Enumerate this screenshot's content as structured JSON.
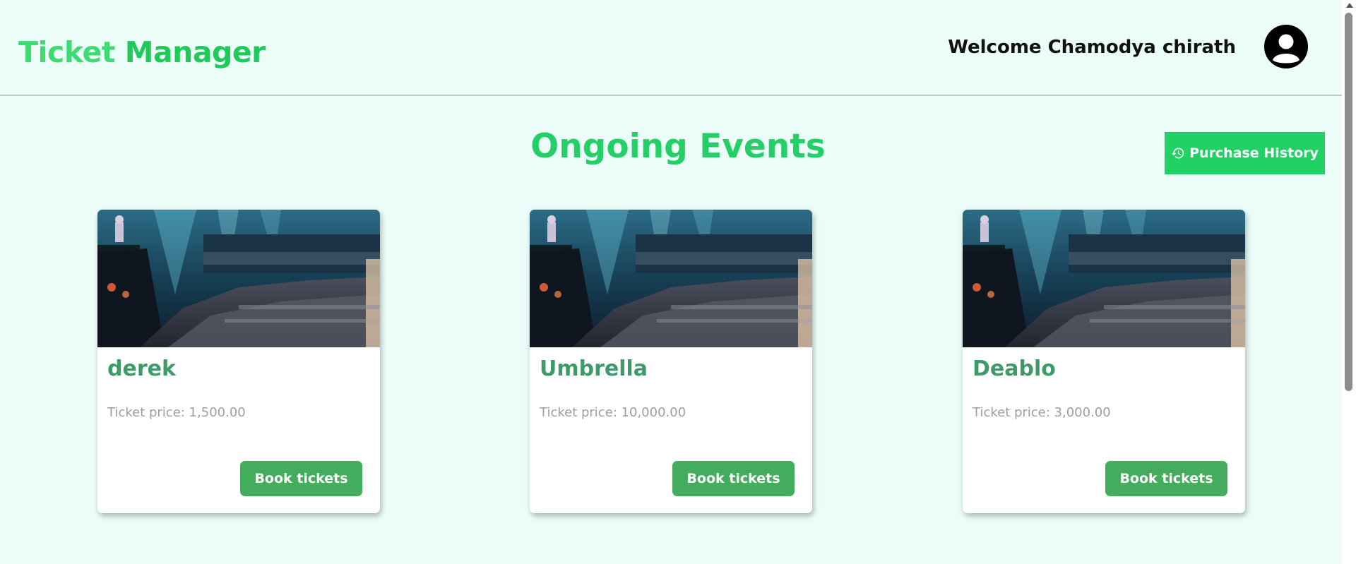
{
  "header": {
    "logo_word1": "Ticket",
    "logo_word2": "Manager",
    "welcome_text": "Welcome Chamodya chirath",
    "avatar_icon": "user-circle-icon"
  },
  "main": {
    "title": "Ongoing Events",
    "history_button": {
      "label": "Purchase History",
      "icon": "history-icon"
    },
    "events": [
      {
        "name": "derek",
        "price_text": "Ticket price: 1,500.00",
        "button_label": "Book tickets",
        "image": "concert-crowd-image"
      },
      {
        "name": "Umbrella",
        "price_text": "Ticket price: 10,000.00",
        "button_label": "Book tickets",
        "image": "concert-crowd-image"
      },
      {
        "name": "Deablo",
        "price_text": "Ticket price: 3,000.00",
        "button_label": "Book tickets",
        "image": "concert-crowd-image"
      }
    ]
  },
  "colors": {
    "background": "#ebfcf9",
    "accent_green": "#22d165",
    "event_name_green": "#3e9a69",
    "book_button_green": "#43ad5d"
  }
}
